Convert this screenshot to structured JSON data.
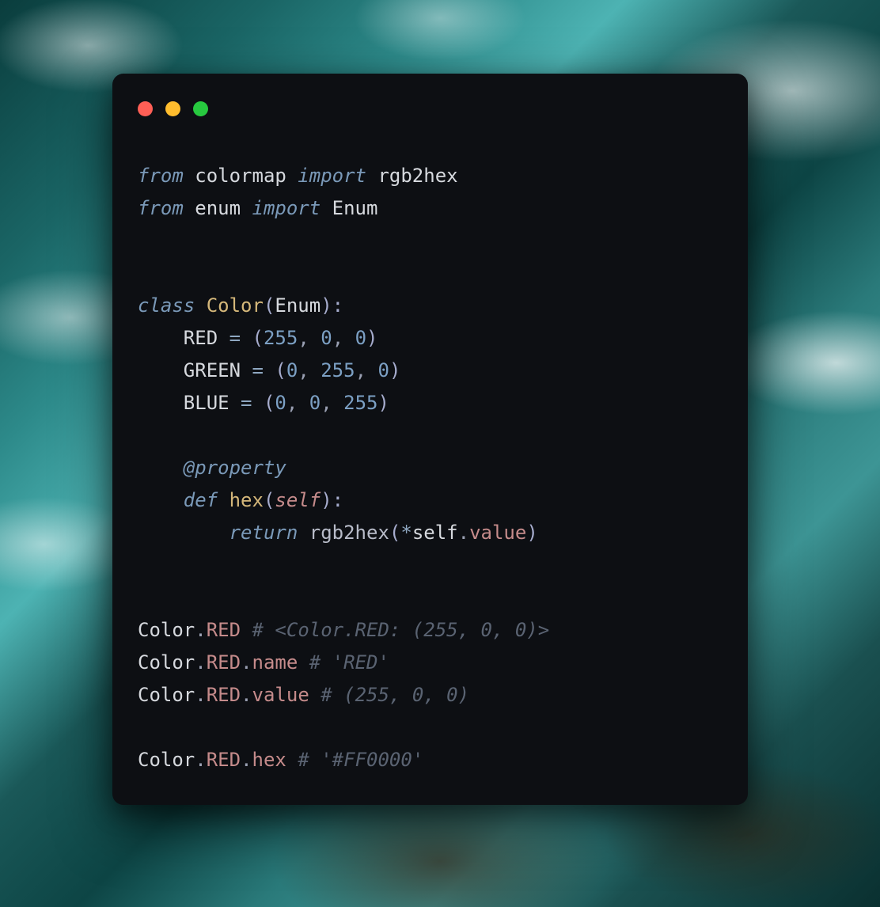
{
  "code": {
    "line1": {
      "from": "from",
      "module1": "colormap",
      "import": "import",
      "name1": "rgb2hex"
    },
    "line2": {
      "from": "from",
      "module2": "enum",
      "import": "import",
      "name2": "Enum"
    },
    "classDecl": {
      "class": "class",
      "name": "Color",
      "paren_open": "(",
      "base": "Enum",
      "paren_close": "):"
    },
    "red": {
      "name": "RED",
      "eq": "=",
      "open": "(",
      "v1": "255",
      "c1": ",",
      "v2": "0",
      "c2": ",",
      "v3": "0",
      "close": ")"
    },
    "green": {
      "name": "GREEN",
      "eq": "=",
      "open": "(",
      "v1": "0",
      "c1": ",",
      "v2": "255",
      "c2": ",",
      "v3": "0",
      "close": ")"
    },
    "blue": {
      "name": "BLUE",
      "eq": "=",
      "open": "(",
      "v1": "0",
      "c1": ",",
      "v2": "0",
      "c2": ",",
      "v3": "255",
      "close": ")"
    },
    "decorator": "@property",
    "method": {
      "def": "def",
      "name": "hex",
      "open": "(",
      "self": "self",
      "close": "):"
    },
    "ret": {
      "return": "return",
      "func": "rgb2hex",
      "open": "(",
      "star": "*",
      "self": "self",
      "dot": ".",
      "value": "value",
      "close": ")"
    },
    "usage1": {
      "class": "Color",
      "dot": ".",
      "member": "RED",
      "comment": "# <Color.RED: (255, 0, 0)>"
    },
    "usage2": {
      "class": "Color",
      "dot1": ".",
      "member": "RED",
      "dot2": ".",
      "attr": "name",
      "comment": "# 'RED'"
    },
    "usage3": {
      "class": "Color",
      "dot1": ".",
      "member": "RED",
      "dot2": ".",
      "attr": "value",
      "comment": "# (255, 0, 0)"
    },
    "usage4": {
      "class": "Color",
      "dot1": ".",
      "member": "RED",
      "dot2": ".",
      "attr": "hex",
      "comment": "# '#FF0000'"
    }
  }
}
